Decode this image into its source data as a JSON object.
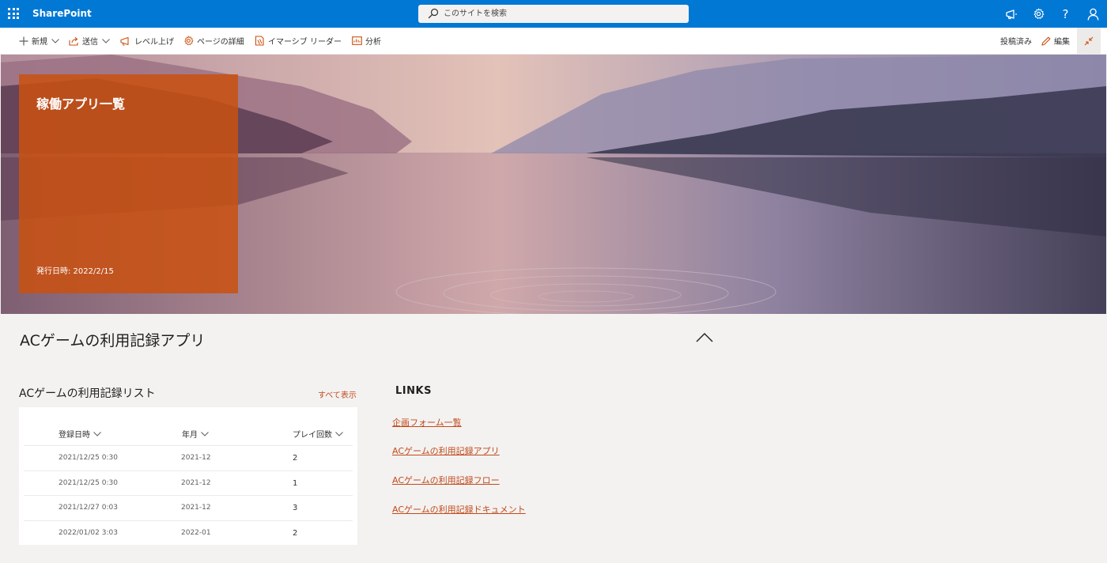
{
  "suite": {
    "brand": "SharePoint",
    "search_placeholder": "このサイトを検索"
  },
  "commandbar": {
    "new_label": "新規",
    "send_label": "送信",
    "promote_label": "レベル上げ",
    "page_details_label": "ページの詳細",
    "immersive_reader_label": "イマーシブ リーダー",
    "analytics_label": "分析",
    "published_label": "投稿済み",
    "edit_label": "編集"
  },
  "hero": {
    "title": "稼働アプリ一覧",
    "published_date": "発行日時: 2022/2/15"
  },
  "section": {
    "title": "ACゲームの利用記録アプリ"
  },
  "list": {
    "title": "ACゲームの利用記録リスト",
    "see_all": "すべて表示",
    "columns": [
      "登録日時",
      "年月",
      "プレイ回数"
    ],
    "rows": [
      [
        "2021/12/25 0:30",
        "2021-12",
        "2"
      ],
      [
        "2021/12/25 0:30",
        "2021-12",
        "1"
      ],
      [
        "2021/12/27 0:03",
        "2021-12",
        "3"
      ],
      [
        "2022/01/02 3:03",
        "2022-01",
        "2"
      ]
    ]
  },
  "links": {
    "title": "LINKS",
    "items": [
      "企画フォーム一覧",
      "ACゲームの利用記録アプリ",
      "ACゲームの利用記録フロー",
      "ACゲームの利用記録ドキュメント"
    ]
  },
  "colors": {
    "suite_bar": "#0078d4",
    "accent": "#ca5010",
    "link": "#c24a1c",
    "page_bg": "#f3f2f1"
  }
}
